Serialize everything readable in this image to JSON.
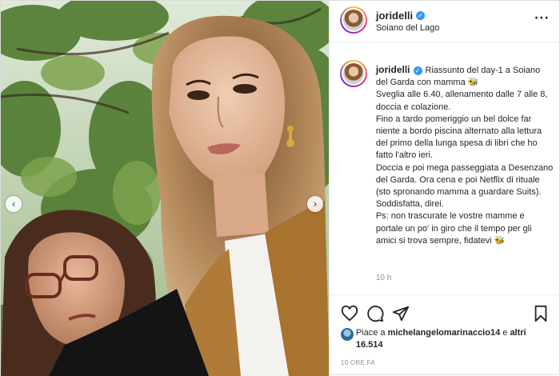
{
  "post": {
    "header": {
      "username": "joridelli",
      "location": "Soiano del Lago",
      "more_icon": "more-horizontal-icon"
    },
    "caption": {
      "username": "joridelli",
      "lines": [
        "Riassunto del day-1 a Soiano del Garda con mamma 🐝",
        "Sveglia alle 6.40, allenamento dalle 7 alle 8, doccia e colazione.",
        "Fino a tardo pomeriggio un bel dolce far niente a bordo piscina alternato alla lettura del primo della lunga spesa di libri che ho fatto l'altro ieri.",
        "Doccia e poi mega passeggiata a Desenzano del Garda. Ora cena e poi Netflix di rituale (sto spronando mamma a guardare Suits).",
        "Soddisfatta, direi.",
        "Ps: non trascurate le vostre mamme e portale un po' in giro che il tempo per gli amici si trova sempre, fidatevi 🐝"
      ],
      "time_ago": "10 h"
    },
    "actions": {
      "like_icon": "heart-icon",
      "comment_icon": "comment-icon",
      "share_icon": "paper-plane-icon",
      "save_icon": "bookmark-icon"
    },
    "likes": {
      "prefix": "Piace a ",
      "user": "michelangelomarinaccio14",
      "middle": " e ",
      "others": "altri 16.514"
    },
    "date": "10 ORE FA",
    "carousel": {
      "prev_icon": "chevron-left-icon",
      "next_icon": "chevron-right-icon"
    }
  }
}
